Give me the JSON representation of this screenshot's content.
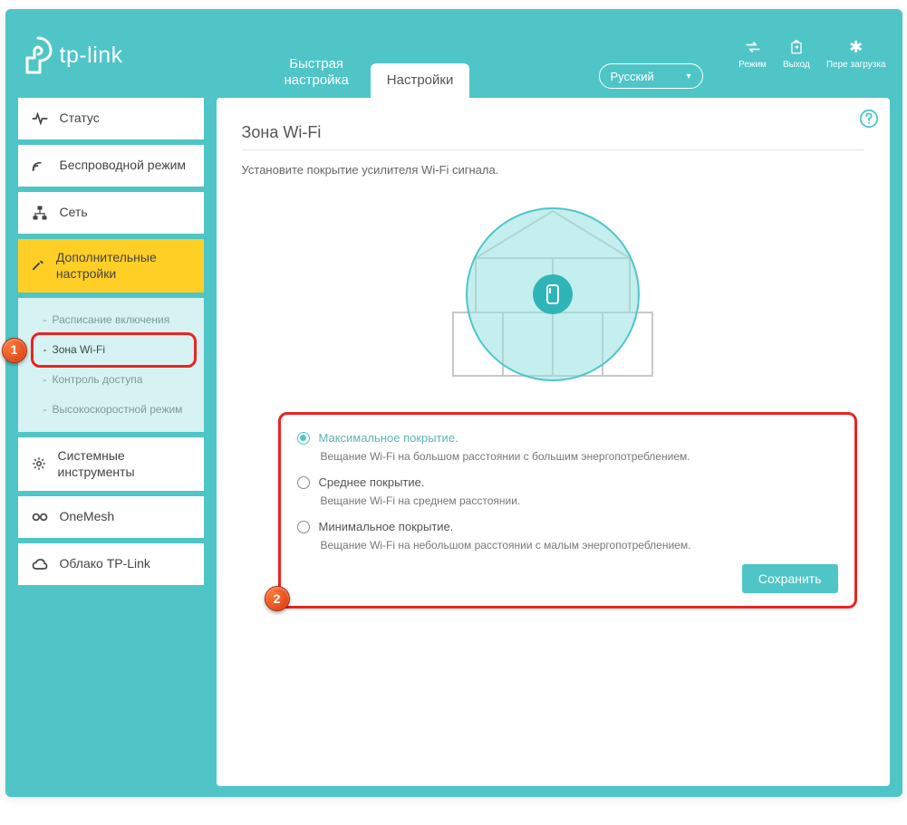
{
  "brand": "tp-link",
  "header": {
    "tabs": [
      {
        "label": "Быстрая\nнастройка",
        "active": false
      },
      {
        "label": "Настройки",
        "active": true
      }
    ],
    "language": "Русский",
    "actions": {
      "mode": "Режим",
      "logout": "Выход",
      "reboot": "Пере загрузка"
    }
  },
  "sidebar": {
    "status": "Статус",
    "wireless": "Беспроводной режим",
    "network": "Сеть",
    "advanced": "Дополнительные настройки",
    "sub": {
      "schedule": "Расписание включения",
      "wifi_zone": "Зона Wi-Fi",
      "access_control": "Контроль доступа",
      "high_speed": "Высокоскоростной режим"
    },
    "system_tools": "Системные инструменты",
    "onemesh": "OneMesh",
    "cloud": "Облако TP-Link"
  },
  "main": {
    "title": "Зона Wi-Fi",
    "subtitle": "Установите покрытие усилителя Wi-Fi сигнала.",
    "options": [
      {
        "label": "Максимальное покрытие.",
        "desc": "Вещание Wi-Fi на большом расстоянии с большим энергопотреблением.",
        "checked": true
      },
      {
        "label": "Среднее покрытие.",
        "desc": "Вещание Wi-Fi на среднем расстоянии.",
        "checked": false
      },
      {
        "label": "Минимальное покрытие.",
        "desc": "Вещание Wi-Fi на небольшом расстоянии с малым энергопотреблением.",
        "checked": false
      }
    ],
    "save": "Сохранить"
  },
  "callouts": {
    "one": "1",
    "two": "2"
  }
}
